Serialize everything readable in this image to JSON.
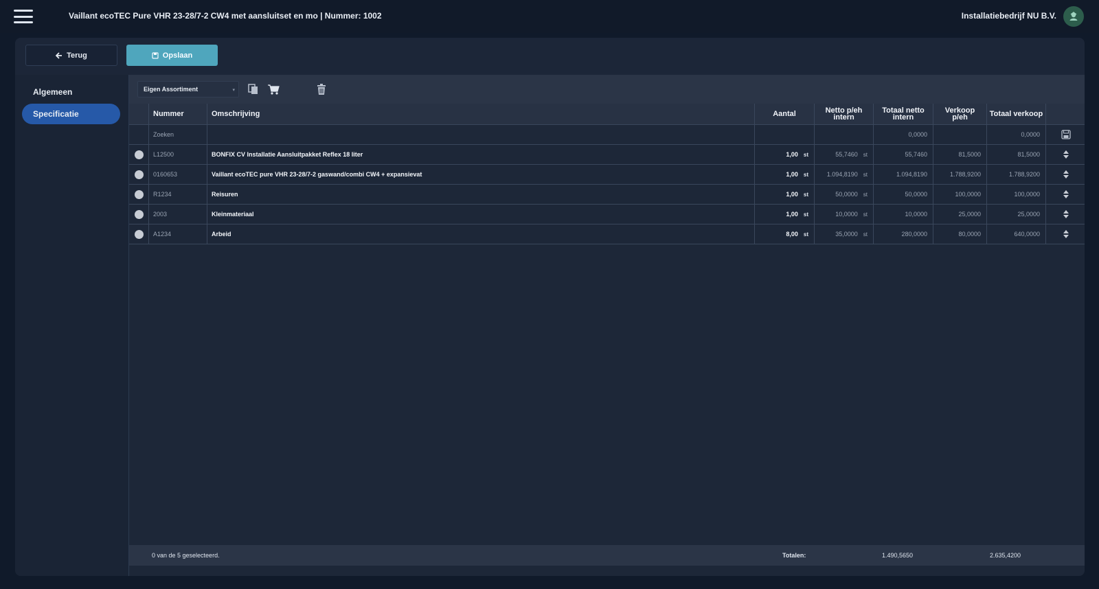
{
  "header": {
    "title": "Vaillant ecoTEC Pure VHR 23-28/7-2 CW4 met aansluitset en mo | Nummer: 1002",
    "company": "Installatiebedrijf NU B.V.",
    "menu_icon": "hamburger-menu-icon",
    "avatar_icon": "user-avatar-icon"
  },
  "actions": {
    "back_label": "Terug",
    "save_label": "Opslaan"
  },
  "sidebar": {
    "items": [
      {
        "label": "Algemeen",
        "active": false
      },
      {
        "label": "Specificatie",
        "active": true
      }
    ]
  },
  "toolbar": {
    "assortment_value": "Eigen Assortiment",
    "icons": [
      "copy-icon",
      "cart-icon",
      "trash-icon"
    ]
  },
  "table": {
    "headers": {
      "nummer": "Nummer",
      "omschrijving": "Omschrijving",
      "aantal": "Aantal",
      "netto_line1": "Netto p/eh",
      "netto_line2": "intern",
      "totaal_netto_line1": "Totaal netto",
      "totaal_netto_line2": "intern",
      "verkoop_line1": "Verkoop",
      "verkoop_line2": "p/eh",
      "totaal_verkoop": "Totaal verkoop"
    },
    "search": {
      "placeholder": "Zoeken",
      "totaal_netto": "0,0000",
      "totaal_verkoop": "0,0000"
    },
    "rows": [
      {
        "nummer": "L12500",
        "omschrijving": "BONFIX CV Installatie Aansluitpakket Reflex 18 liter",
        "aantal": "1,00",
        "eenheid": "st",
        "netto": "55,7460",
        "netto_eenheid": "st",
        "totaal_netto": "55,7460",
        "verkoop": "81,5000",
        "totaal_verkoop": "81,5000"
      },
      {
        "nummer": "0160653",
        "omschrijving": "Vaillant ecoTEC pure VHR 23-28/7-2 gaswand/combi CW4 + expansievat",
        "aantal": "1,00",
        "eenheid": "st",
        "netto": "1.094,8190",
        "netto_eenheid": "st",
        "totaal_netto": "1.094,8190",
        "verkoop": "1.788,9200",
        "totaal_verkoop": "1.788,9200"
      },
      {
        "nummer": "R1234",
        "omschrijving": "Reisuren",
        "aantal": "1,00",
        "eenheid": "st",
        "netto": "50,0000",
        "netto_eenheid": "st",
        "totaal_netto": "50,0000",
        "verkoop": "100,0000",
        "totaal_verkoop": "100,0000"
      },
      {
        "nummer": "2003",
        "omschrijving": "Kleinmateriaal",
        "aantal": "1,00",
        "eenheid": "st",
        "netto": "10,0000",
        "netto_eenheid": "st",
        "totaal_netto": "10,0000",
        "verkoop": "25,0000",
        "totaal_verkoop": "25,0000"
      },
      {
        "nummer": "A1234",
        "omschrijving": "Arbeid",
        "aantal": "8,00",
        "eenheid": "st",
        "netto": "35,0000",
        "netto_eenheid": "st",
        "totaal_netto": "280,0000",
        "verkoop": "80,0000",
        "totaal_verkoop": "640,0000"
      }
    ]
  },
  "footer": {
    "selection": "0 van de 5 geselecteerd.",
    "totals_label": "Totalen:",
    "totaal_netto": "1.490,5650",
    "totaal_verkoop": "2.635,4200"
  },
  "colors": {
    "background": "#101a2a",
    "panel": "#1c2638",
    "accent": "#4fa6bd",
    "active_nav": "#2659a8"
  }
}
